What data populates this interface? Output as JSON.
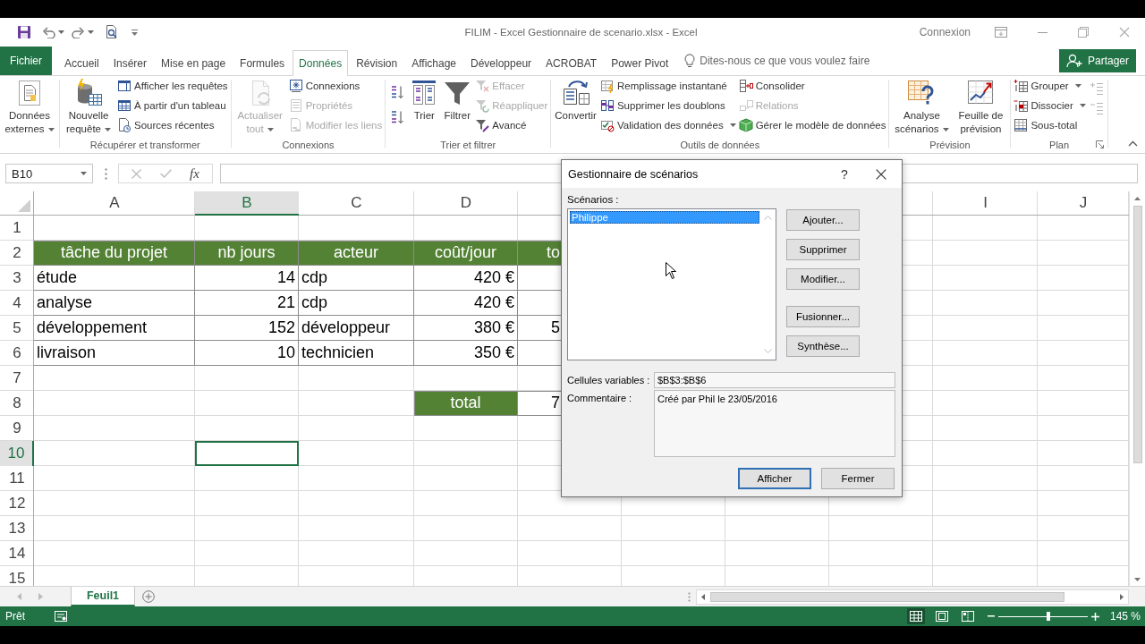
{
  "title_bar": {
    "title": "FILIM - Excel Gestionnaire de scenario.xlsx - Excel",
    "account": "Connexion"
  },
  "tabs": [
    {
      "label": "Fichier",
      "kind": "file",
      "selected": false
    },
    {
      "label": "Accueil",
      "kind": "tab",
      "selected": false
    },
    {
      "label": "Insérer",
      "kind": "tab",
      "selected": false
    },
    {
      "label": "Mise en page",
      "kind": "tab",
      "selected": false
    },
    {
      "label": "Formules",
      "kind": "tab",
      "selected": false
    },
    {
      "label": "Données",
      "kind": "tab",
      "selected": true
    },
    {
      "label": "Révision",
      "kind": "tab",
      "selected": false
    },
    {
      "label": "Affichage",
      "kind": "tab",
      "selected": false
    },
    {
      "label": "Développeur",
      "kind": "tab",
      "selected": false
    },
    {
      "label": "ACROBAT",
      "kind": "tab",
      "selected": false
    },
    {
      "label": "Power Pivot",
      "kind": "tab",
      "selected": false
    }
  ],
  "tell_me": {
    "placeholder": "Dites-nous ce que vous voulez faire"
  },
  "share_button": "Partager",
  "ribbon": {
    "groups": [
      {
        "launcher": false,
        "controls": [
          {
            "kind": "large",
            "label": "Données externes",
            "dropdown": true,
            "disabled": false
          }
        ]
      },
      {
        "label": "Récupérer et transformer",
        "launcher": false,
        "controls": [
          {
            "kind": "large",
            "label": "Nouvelle requête",
            "dropdown": true,
            "disabled": false
          },
          {
            "kind": "stack",
            "items": [
              {
                "label": "Afficher les requêtes",
                "dropdown": false,
                "disabled": false
              },
              {
                "label": "À partir d'un tableau",
                "dropdown": false,
                "disabled": false
              },
              {
                "label": "Sources récentes",
                "dropdown": false,
                "disabled": false
              }
            ]
          }
        ]
      },
      {
        "label": "Connexions",
        "launcher": false,
        "controls": [
          {
            "kind": "large",
            "label": "Actualiser tout",
            "dropdown": true,
            "disabled": true
          },
          {
            "kind": "stack",
            "items": [
              {
                "label": "Connexions",
                "dropdown": false,
                "disabled": false
              },
              {
                "label": "Propriétés",
                "dropdown": false,
                "disabled": true
              },
              {
                "label": "Modifier les liens",
                "dropdown": false,
                "disabled": true
              }
            ]
          }
        ]
      },
      {
        "label": "Trier et filtrer",
        "launcher": false,
        "controls": [
          {
            "kind": "sort_buttons",
            "disabled": false
          },
          {
            "kind": "large",
            "label": "Trier",
            "dropdown": false,
            "disabled": false
          },
          {
            "kind": "large",
            "label": "Filtrer",
            "dropdown": false,
            "disabled": false
          },
          {
            "kind": "stack",
            "items": [
              {
                "label": "Effacer",
                "dropdown": false,
                "disabled": true
              },
              {
                "label": "Réappliquer",
                "dropdown": false,
                "disabled": true
              },
              {
                "label": "Avancé",
                "dropdown": false,
                "disabled": false
              }
            ]
          }
        ]
      },
      {
        "label": "Outils de données",
        "launcher": false,
        "controls": [
          {
            "kind": "large",
            "label": "Convertir",
            "dropdown": false,
            "disabled": false
          },
          {
            "kind": "stack",
            "items": [
              {
                "label": "Remplissage instantané",
                "dropdown": false,
                "disabled": false
              },
              {
                "label": "Supprimer les doublons",
                "dropdown": false,
                "disabled": false
              },
              {
                "label": "Validation des données",
                "dropdown": true,
                "disabled": false
              }
            ]
          },
          {
            "kind": "stack",
            "items": [
              {
                "label": "Consolider",
                "dropdown": false,
                "disabled": false
              },
              {
                "label": "Relations",
                "dropdown": false,
                "disabled": true
              },
              {
                "label": "Gérer le modèle de données",
                "dropdown": false,
                "disabled": false
              }
            ]
          }
        ]
      },
      {
        "label": "Prévision",
        "launcher": false,
        "controls": [
          {
            "kind": "large",
            "label": "Analyse scénarios",
            "dropdown": true,
            "disabled": false
          },
          {
            "kind": "large",
            "label": "Feuille de prévision",
            "dropdown": false,
            "disabled": false
          }
        ]
      },
      {
        "label": "Plan",
        "launcher": true,
        "controls": [
          {
            "kind": "stack",
            "items": [
              {
                "label": "Grouper",
                "dropdown": true,
                "disabled": false
              },
              {
                "label": "Dissocier",
                "dropdown": true,
                "disabled": false
              },
              {
                "label": "Sous-total",
                "dropdown": false,
                "disabled": false
              }
            ]
          },
          {
            "kind": "detail_buttons",
            "disabled": true
          }
        ]
      }
    ]
  },
  "formula_bar": {
    "name_box": "B10",
    "function_label": "fx"
  },
  "sheet": {
    "columns": [
      {
        "label": "A",
        "selected": false
      },
      {
        "label": "B",
        "selected": true
      },
      {
        "label": "C",
        "selected": false
      },
      {
        "label": "D",
        "selected": false
      },
      {
        "label": "I",
        "selected": false
      },
      {
        "label": "J",
        "selected": false
      }
    ],
    "rows": [
      {
        "number": "1",
        "selected": false
      },
      {
        "number": "2",
        "selected": false,
        "cells": [
          {
            "kind": "header",
            "text": "tâche du projet",
            "selected": false
          },
          {
            "kind": "header",
            "text": "nb jours",
            "selected": false
          },
          {
            "kind": "header",
            "text": "acteur",
            "selected": false
          },
          {
            "kind": "header",
            "text": "coût/jour",
            "selected": false
          },
          {
            "kind": "header",
            "text": "to",
            "selected": false
          }
        ]
      },
      {
        "number": "3",
        "selected": false,
        "cells": [
          {
            "kind": "text",
            "text": "étude",
            "selected": false
          },
          {
            "kind": "number",
            "text": "14",
            "selected": false
          },
          {
            "kind": "text",
            "text": "cdp",
            "selected": false
          },
          {
            "kind": "number",
            "text": "420 €",
            "selected": false
          },
          {
            "kind": "number",
            "selected": false
          }
        ]
      },
      {
        "number": "4",
        "selected": false,
        "cells": [
          {
            "kind": "text",
            "text": "analyse",
            "selected": false
          },
          {
            "kind": "number",
            "text": "21",
            "selected": false
          },
          {
            "kind": "text",
            "text": "cdp",
            "selected": false
          },
          {
            "kind": "number",
            "text": "420 €",
            "selected": false
          },
          {
            "kind": "number",
            "selected": false
          }
        ]
      },
      {
        "number": "5",
        "selected": false,
        "cells": [
          {
            "kind": "text",
            "text": "développement",
            "selected": false
          },
          {
            "kind": "number",
            "text": "152",
            "selected": false
          },
          {
            "kind": "text",
            "text": "développeur",
            "selected": false
          },
          {
            "kind": "number",
            "text": "380 €",
            "selected": false
          },
          {
            "kind": "number",
            "text": "5",
            "selected": false
          }
        ]
      },
      {
        "number": "6",
        "selected": false,
        "cells": [
          {
            "kind": "text",
            "text": "livraison",
            "selected": false
          },
          {
            "kind": "number",
            "text": "10",
            "selected": false
          },
          {
            "kind": "text",
            "text": "technicien",
            "selected": false
          },
          {
            "kind": "number",
            "text": "350 €",
            "selected": false
          },
          {
            "kind": "number",
            "selected": false
          }
        ]
      },
      {
        "number": "7",
        "selected": false
      },
      {
        "number": "8",
        "selected": false,
        "cells": [
          {
            "kind": "empty",
            "selected": false
          },
          {
            "kind": "empty",
            "selected": false
          },
          {
            "kind": "empty",
            "selected": false
          },
          {
            "kind": "header",
            "text": "total",
            "selected": false
          },
          {
            "kind": "number",
            "text": "7",
            "selected": false
          }
        ]
      },
      {
        "number": "9",
        "selected": false
      },
      {
        "number": "10",
        "selected": true,
        "cells": [
          {
            "kind": "empty",
            "selected": false
          },
          {
            "kind": "empty",
            "selected": true
          }
        ]
      },
      {
        "number": "11",
        "selected": false
      },
      {
        "number": "12",
        "selected": false
      },
      {
        "number": "13",
        "selected": false
      },
      {
        "number": "14",
        "selected": false
      },
      {
        "number": "15",
        "selected": false
      }
    ]
  },
  "sheet_tabs": [
    {
      "label": "Feuil1",
      "selected": true
    }
  ],
  "status_bar": {
    "status": "Prêt",
    "views": [
      {
        "kind": "normal",
        "selected": true
      },
      {
        "kind": "page_layout",
        "selected": false
      },
      {
        "kind": "page_break",
        "selected": false
      }
    ],
    "zoom": {
      "level": 0.56
    },
    "zoom_label": "145 %"
  },
  "dialog": {
    "title": "Gestionnaire de scénarios",
    "help": "?",
    "list_label": "Scénarios :",
    "scenarios": [
      {
        "label": "Philippe",
        "selected": true
      }
    ],
    "button_groups": [
      [
        "Ajouter...",
        "Supprimer",
        "Modifier..."
      ],
      [
        "Fusionner...",
        "Synthèse..."
      ]
    ],
    "changing_cells_label": "Cellules variables :",
    "changing_cells": "$B$3:$B$6",
    "comment_label": "Commentaire :",
    "comment": "Créé par Phil le 23/05/2016",
    "buttons": [
      {
        "label": "Afficher",
        "default": true
      },
      {
        "label": "Fermer",
        "default": false
      }
    ]
  }
}
